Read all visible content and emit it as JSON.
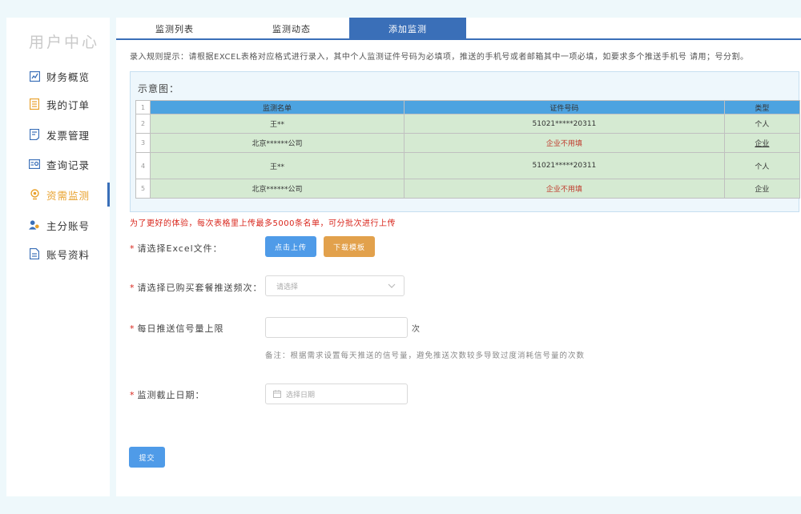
{
  "sidebar": {
    "title": "用户中心",
    "items": [
      {
        "label": "财务概览",
        "icon": "finance-overview-icon"
      },
      {
        "label": "我的订单",
        "icon": "order-list-icon"
      },
      {
        "label": "发票管理",
        "icon": "invoice-icon"
      },
      {
        "label": "查询记录",
        "icon": "query-record-icon"
      },
      {
        "label": "资需监测",
        "icon": "monitor-icon",
        "active": true
      },
      {
        "label": "主分账号",
        "icon": "accounts-icon"
      },
      {
        "label": "账号资料",
        "icon": "profile-icon"
      }
    ]
  },
  "tabs": [
    {
      "label": "监测列表"
    },
    {
      "label": "监测动态"
    },
    {
      "label": "添加监测",
      "active": true
    }
  ],
  "rules_text": "录入规则提示：请根据EXCEL表格对应格式进行录入，其中个人监测证件号码为必填项，推送的手机号或者邮箱其中一项必填，如要求多个推送手机号 请用；号分割。",
  "sample": {
    "label": "示意图：",
    "header": {
      "num": "1",
      "cols": [
        "监测名单",
        "证件号码",
        "类型"
      ]
    },
    "rows": [
      {
        "num": "2",
        "name": "王**",
        "id": "51021*****20311",
        "type": "个人"
      },
      {
        "num": "3",
        "name": "北京******公司",
        "id": "企业不用填",
        "type": "企业"
      },
      {
        "num": "4",
        "name": "王**",
        "id": "51021*****20311",
        "type": "个人"
      },
      {
        "num": "5",
        "name": "北京******公司",
        "id": "企业不用填",
        "type": "企业"
      }
    ]
  },
  "warning": "为了更好的体验，每次表格里上传最多5000条名单，可分批次进行上传",
  "form": {
    "excel_label": "请选择Excel文件：",
    "upload_button": "点击上传",
    "download_button": "下载模板",
    "package_label": "请选择已购买套餐推送频次：",
    "package_placeholder": "请选择",
    "limit_label": "每日推送信号量上限",
    "limit_unit": "次",
    "limit_note": "备注：根据需求设置每天推送的信号量，避免推送次数较多导致过度消耗信号量的次数",
    "date_label": "监测截止日期：",
    "date_placeholder": "选择日期",
    "submit_button": "提交"
  },
  "colors": {
    "accent": "#3a6fb8",
    "active_menu": "#e8a02a",
    "warning": "#d9261c",
    "upload": "#4f9be8",
    "download": "#e2a14c"
  }
}
